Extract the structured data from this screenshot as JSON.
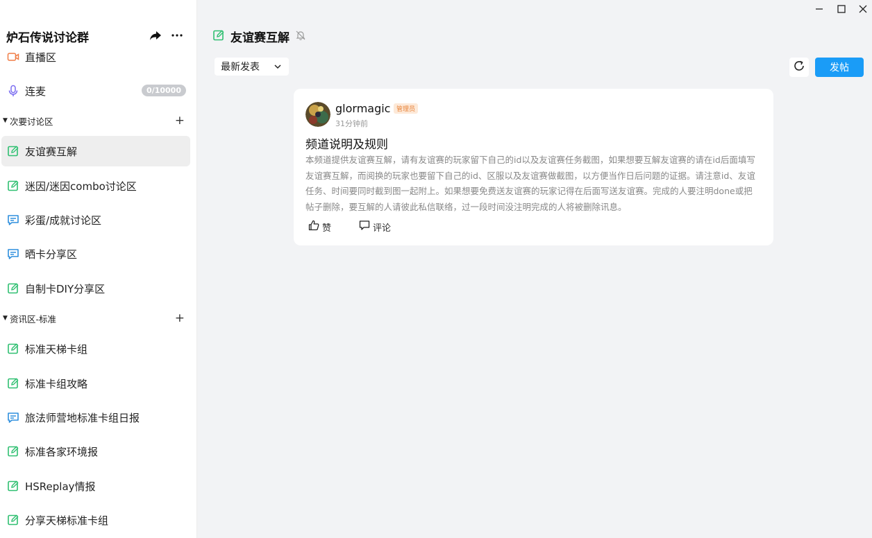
{
  "guild": {
    "name": "炉石传说讨论群"
  },
  "top_channels": [
    {
      "label": "直播区",
      "icon": "video-camera-icon"
    },
    {
      "label": "连麦",
      "icon": "microphone-icon",
      "badge": "0/10000"
    }
  ],
  "categories": [
    {
      "name": "次要讨论区",
      "channels": [
        {
          "label": "友谊赛互解",
          "icon": "post-edit-icon",
          "active": true
        },
        {
          "label": "迷因/迷因combo讨论区",
          "icon": "post-edit-icon"
        },
        {
          "label": "彩蛋/成就讨论区",
          "icon": "chat-bubble-icon"
        },
        {
          "label": "晒卡分享区",
          "icon": "chat-bubble-icon"
        },
        {
          "label": "自制卡DIY分享区",
          "icon": "post-edit-icon"
        }
      ]
    },
    {
      "name": "资讯区-标准",
      "channels": [
        {
          "label": "标准天梯卡组",
          "icon": "post-edit-icon"
        },
        {
          "label": "标准卡组攻略",
          "icon": "post-edit-icon"
        },
        {
          "label": "旅法师营地标准卡组日报",
          "icon": "chat-bubble-icon"
        },
        {
          "label": "标准各家环境报",
          "icon": "post-edit-icon"
        },
        {
          "label": "HSReplay情报",
          "icon": "post-edit-icon"
        },
        {
          "label": "分享天梯标准卡组",
          "icon": "post-edit-icon"
        }
      ]
    }
  ],
  "channel": {
    "title": "友谊赛互解"
  },
  "toolbar": {
    "sort_label": "最新发表",
    "post_label": "发帖"
  },
  "post": {
    "author": "glormagic",
    "role": "管理员",
    "time": "31分钟前",
    "title": "频道说明及规则",
    "body": "本频道提供友谊赛互解，请有友谊赛的玩家留下自己的id以及友谊赛任务截图，如果想要互解友谊赛的请在id后面填写友谊赛互解，而阅换的玩家也要留下自己的id、区服以及友谊赛做截图，以方便当作日后问题的证据。请注意id、友谊任务、时间要同时截到图一起附上。如果想要免费送友谊赛的玩家记得在后面写送友谊赛。完成的人要注明done或把帖子删除，要互解的人请彼此私信联络，过一段时间没注明完成的人将被删除讯息。",
    "like_label": "赞",
    "comment_label": "评论"
  },
  "colors": {
    "accent": "#1a9cf7",
    "green_icon": "#2fbf71",
    "blue_icon": "#2f8fdd",
    "orange_icon": "#f07c45",
    "mic_icon": "#7a6cf0"
  }
}
